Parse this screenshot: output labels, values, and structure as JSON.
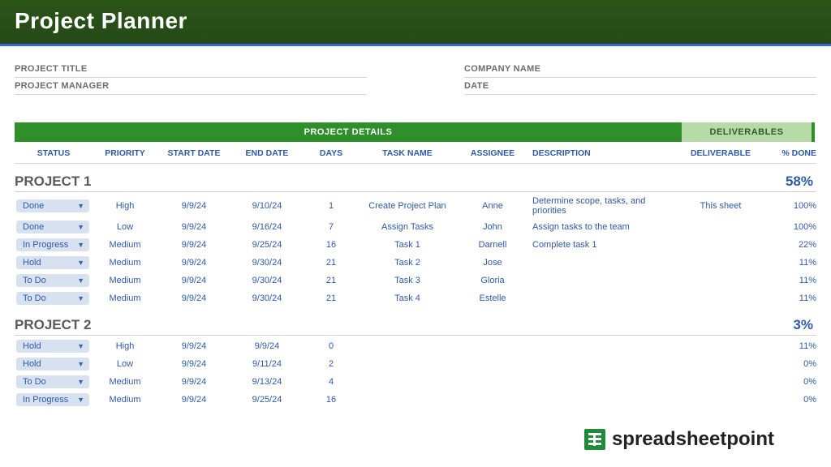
{
  "title": "Project Planner",
  "meta": {
    "left": [
      {
        "label": "PROJECT TITLE",
        "value": ""
      },
      {
        "label": "PROJECT MANAGER",
        "value": ""
      }
    ],
    "right": [
      {
        "label": "COMPANY NAME",
        "value": ""
      },
      {
        "label": "DATE",
        "value": ""
      }
    ]
  },
  "bands": {
    "project": "PROJECT DETAILS",
    "deliverables": "DELIVERABLES"
  },
  "columns": {
    "status": "STATUS",
    "priority": "PRIORITY",
    "start": "START DATE",
    "end": "END DATE",
    "days": "DAYS",
    "task": "TASK NAME",
    "assignee": "ASSIGNEE",
    "description": "DESCRIPTION",
    "deliverable": "DELIVERABLE",
    "done": "% DONE"
  },
  "projects": [
    {
      "name": "PROJECT 1",
      "pct": "58%",
      "tasks": [
        {
          "status": "Done",
          "priority": "High",
          "start": "9/9/24",
          "end": "9/10/24",
          "days": "1",
          "task": "Create Project Plan",
          "assignee": "Anne",
          "description": "Determine scope, tasks, and priorities",
          "deliverable": "This sheet",
          "done": "100%"
        },
        {
          "status": "Done",
          "priority": "Low",
          "start": "9/9/24",
          "end": "9/16/24",
          "days": "7",
          "task": "Assign Tasks",
          "assignee": "John",
          "description": "Assign tasks to the team",
          "deliverable": "",
          "done": "100%"
        },
        {
          "status": "In Progress",
          "priority": "Medium",
          "start": "9/9/24",
          "end": "9/25/24",
          "days": "16",
          "task": "Task 1",
          "assignee": "Darnell",
          "description": "Complete task 1",
          "deliverable": "",
          "done": "22%"
        },
        {
          "status": "Hold",
          "priority": "Medium",
          "start": "9/9/24",
          "end": "9/30/24",
          "days": "21",
          "task": "Task 2",
          "assignee": "Jose",
          "description": "",
          "deliverable": "",
          "done": "11%"
        },
        {
          "status": "To Do",
          "priority": "Medium",
          "start": "9/9/24",
          "end": "9/30/24",
          "days": "21",
          "task": "Task 3",
          "assignee": "Gloria",
          "description": "",
          "deliverable": "",
          "done": "11%"
        },
        {
          "status": "To Do",
          "priority": "Medium",
          "start": "9/9/24",
          "end": "9/30/24",
          "days": "21",
          "task": "Task 4",
          "assignee": "Estelle",
          "description": "",
          "deliverable": "",
          "done": "11%"
        }
      ]
    },
    {
      "name": "PROJECT 2",
      "pct": "3%",
      "tasks": [
        {
          "status": "Hold",
          "priority": "High",
          "start": "9/9/24",
          "end": "9/9/24",
          "days": "0",
          "task": "",
          "assignee": "",
          "description": "",
          "deliverable": "",
          "done": "11%"
        },
        {
          "status": "Hold",
          "priority": "Low",
          "start": "9/9/24",
          "end": "9/11/24",
          "days": "2",
          "task": "",
          "assignee": "",
          "description": "",
          "deliverable": "",
          "done": "0%"
        },
        {
          "status": "To Do",
          "priority": "Medium",
          "start": "9/9/24",
          "end": "9/13/24",
          "days": "4",
          "task": "",
          "assignee": "",
          "description": "",
          "deliverable": "",
          "done": "0%"
        },
        {
          "status": "In Progress",
          "priority": "Medium",
          "start": "9/9/24",
          "end": "9/25/24",
          "days": "16",
          "task": "",
          "assignee": "",
          "description": "",
          "deliverable": "",
          "done": "0%"
        }
      ]
    }
  ],
  "watermark": "spreadsheetpoint"
}
